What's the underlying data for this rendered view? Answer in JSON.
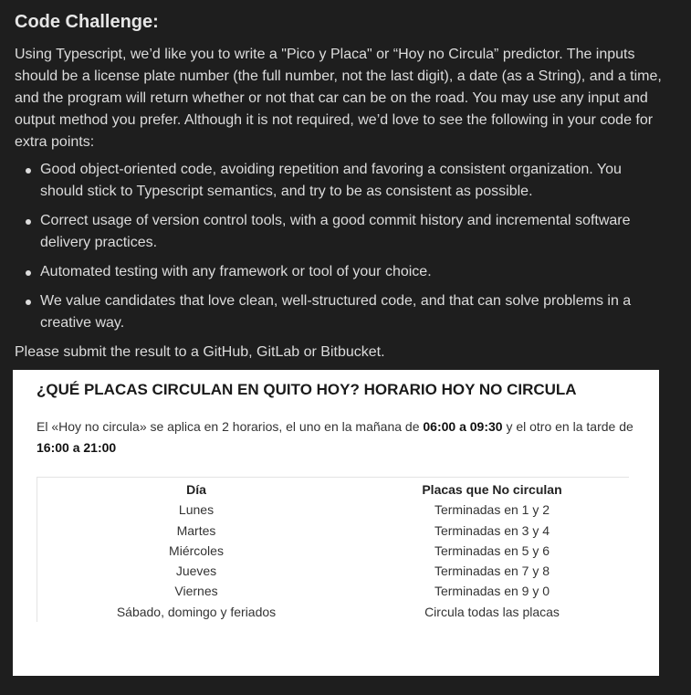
{
  "heading": "Code Challenge:",
  "intro": "Using Typescript, we’d like you to write a \"Pico y Placa\" or “Hoy no Circula” predictor. The inputs should be a license plate number (the full number, not the last digit), a date (as a String), and a time, and the program will return whether or not that car can be on the road. You may use any input and output method you prefer. Although it is not required, we’d love to see the following in your code for extra points:",
  "bullets": [
    "Good object-oriented code, avoiding repetition and favoring a consistent organization. You should stick to Typescript semantics, and try to be as consistent as possible.",
    "Correct usage of version control tools, with a good commit history and incremental software delivery practices.",
    "Automated testing with any framework or tool of your choice.",
    "We value candidates that love clean, well-structured code, and that can solve problems in a creative way."
  ],
  "submit": "Please submit the result to a GitHub, GitLab or Bitbucket.",
  "image": {
    "title": "¿QUÉ PLACAS CIRCULAN EN QUITO HOY? HORARIO HOY NO CIRCULA",
    "desc_part1": "El «Hoy no circula» se aplica en 2 horarios, el uno en la mañana de ",
    "desc_bold1": "06:00 a 09:30",
    "desc_part2": " y el otro en la tarde de ",
    "desc_bold2": "16:00 a 21:00",
    "table": {
      "headers": [
        "Día",
        "Placas que No circulan"
      ],
      "rows": [
        [
          "Lunes",
          "Terminadas en 1 y 2"
        ],
        [
          "Martes",
          "Terminadas en 3 y 4"
        ],
        [
          "Miércoles",
          "Terminadas en 5 y 6"
        ],
        [
          "Jueves",
          "Terminadas en 7 y 8"
        ],
        [
          "Viernes",
          "Terminadas en 9 y 0"
        ],
        [
          "Sábado, domingo y feriados",
          "Circula todas las placas"
        ]
      ]
    }
  },
  "colors": {
    "background": "#1e1e1e",
    "text": "#dcdcdc",
    "image_background": "#ffffff"
  }
}
